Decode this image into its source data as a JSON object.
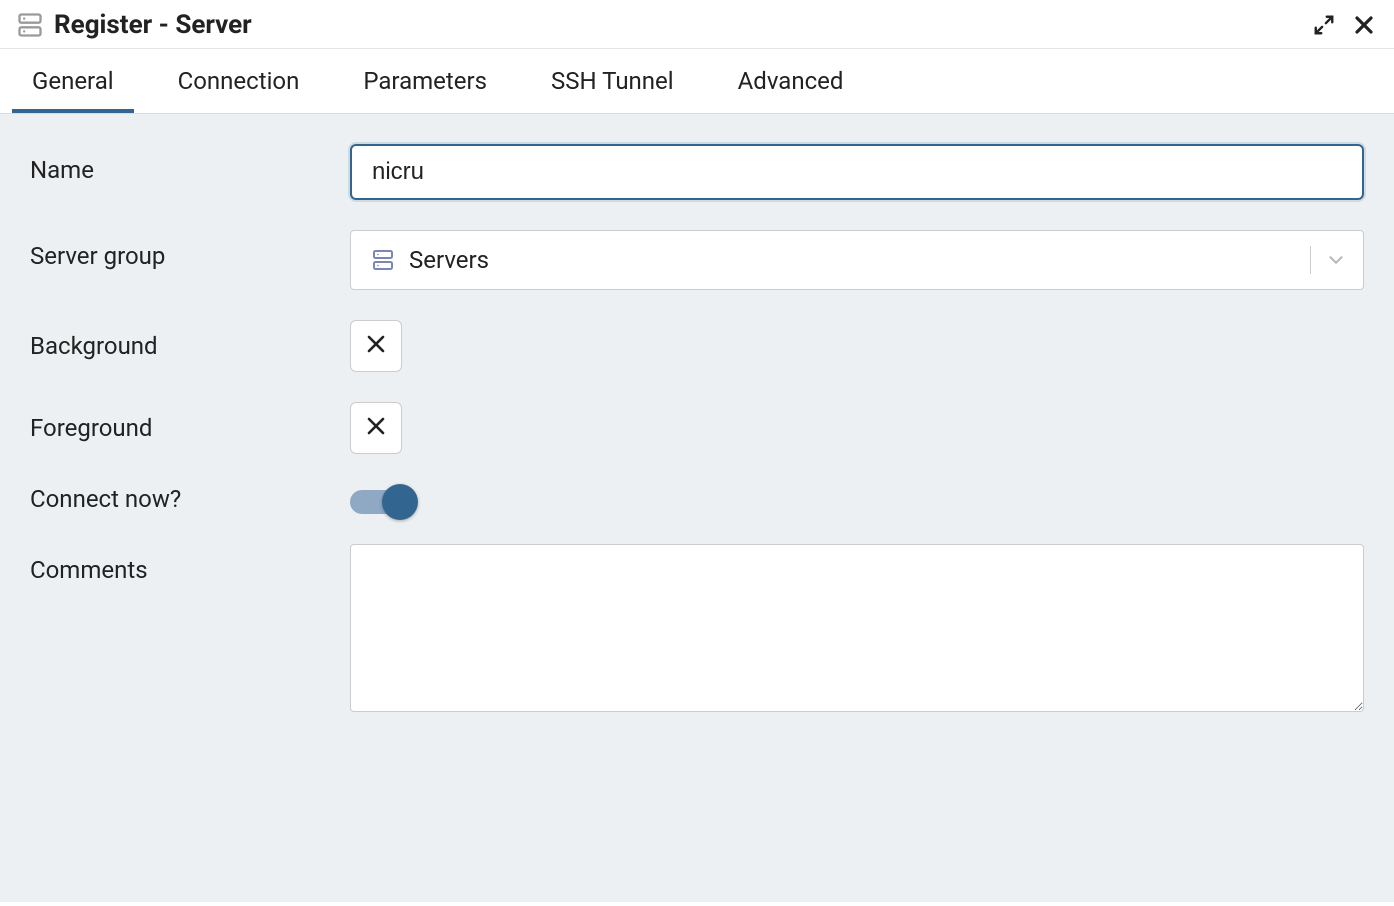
{
  "title": "Register - Server",
  "tabs": [
    {
      "label": "General",
      "active": true
    },
    {
      "label": "Connection",
      "active": false
    },
    {
      "label": "Parameters",
      "active": false
    },
    {
      "label": "SSH Tunnel",
      "active": false
    },
    {
      "label": "Advanced",
      "active": false
    }
  ],
  "form": {
    "name": {
      "label": "Name",
      "value": "nicru"
    },
    "server_group": {
      "label": "Server group",
      "selected": "Servers"
    },
    "background": {
      "label": "Background"
    },
    "foreground": {
      "label": "Foreground"
    },
    "connect_now": {
      "label": "Connect now?",
      "value": true
    },
    "comments": {
      "label": "Comments",
      "value": ""
    }
  }
}
